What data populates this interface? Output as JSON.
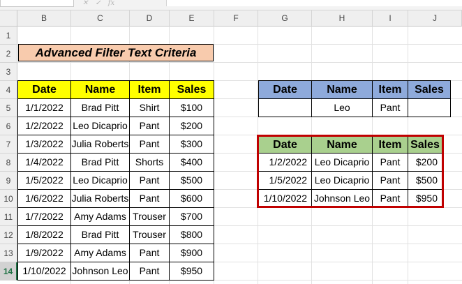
{
  "columns": [
    "B",
    "C",
    "D",
    "E",
    "F",
    "G",
    "H",
    "I",
    "J"
  ],
  "rows": [
    "1",
    "2",
    "3",
    "4",
    "5",
    "6",
    "7",
    "8",
    "9",
    "10",
    "11",
    "12",
    "13",
    "14"
  ],
  "formula_bar": {
    "icons": [
      "cancel-icon",
      "enter-icon",
      "function-icon"
    ],
    "fx": "fx"
  },
  "title": "Advanced Filter Text Criteria",
  "data_table": {
    "headers": [
      "Date",
      "Name",
      "Item",
      "Sales"
    ],
    "rows": [
      [
        "1/1/2022",
        "Brad Pitt",
        "Shirt",
        "$100"
      ],
      [
        "1/2/2022",
        "Leo Dicaprio",
        "Pant",
        "$200"
      ],
      [
        "1/3/2022",
        "Julia Roberts",
        "Pant",
        "$300"
      ],
      [
        "1/4/2022",
        "Brad Pitt",
        "Shorts",
        "$400"
      ],
      [
        "1/5/2022",
        "Leo Dicaprio",
        "Pant",
        "$500"
      ],
      [
        "1/6/2022",
        "Julia Roberts",
        "Pant",
        "$600"
      ],
      [
        "1/7/2022",
        "Amy Adams",
        "Trouser",
        "$700"
      ],
      [
        "1/8/2022",
        "Brad Pitt",
        "Trouser",
        "$800"
      ],
      [
        "1/9/2022",
        "Amy Adams",
        "Pant",
        "$900"
      ],
      [
        "1/10/2022",
        "Johnson Leo",
        "Pant",
        "$950"
      ]
    ]
  },
  "criteria_table": {
    "headers": [
      "Date",
      "Name",
      "Item",
      "Sales"
    ],
    "row": [
      "",
      "Leo",
      "Pant",
      ""
    ]
  },
  "result_table": {
    "headers": [
      "Date",
      "Name",
      "Item",
      "Sales"
    ],
    "rows": [
      [
        "1/2/2022",
        "Leo Dicaprio",
        "Pant",
        "$200"
      ],
      [
        "1/5/2022",
        "Leo Dicaprio",
        "Pant",
        "$500"
      ],
      [
        "1/10/2022",
        "Johnson Leo",
        "Pant",
        "$950"
      ]
    ]
  },
  "colors": {
    "title_fill": "#f8cbad",
    "data_header": "#ffff00",
    "criteria_header": "#8eaadb",
    "result_header": "#a9d08e",
    "highlight_border": "#c00000"
  }
}
